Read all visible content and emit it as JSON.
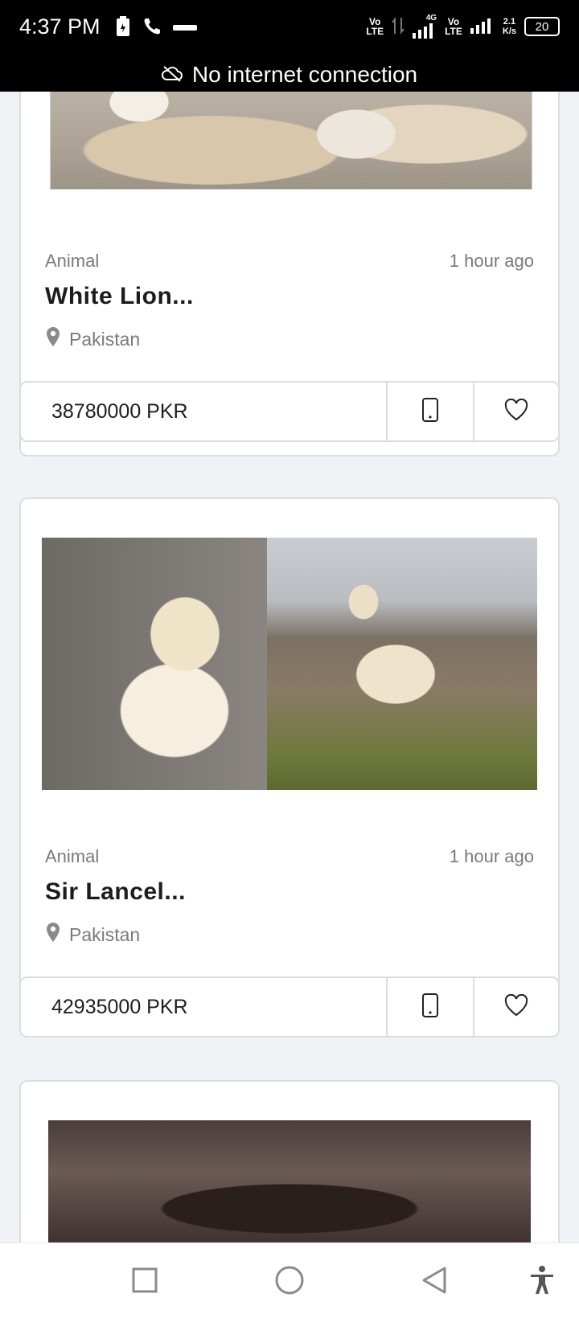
{
  "status_bar": {
    "time": "4:37 PM",
    "network_1": [
      "Vo",
      "LTE"
    ],
    "network_2": [
      "Vo",
      "LTE"
    ],
    "network_4g": "4G",
    "speed": [
      "2.1",
      "K/s"
    ],
    "battery": "20",
    "icons": [
      "battery-saver-icon",
      "phone-call-icon",
      "minus-icon",
      "signal-icon"
    ]
  },
  "banner": {
    "text": "No internet connection",
    "icon": "cloud-off-icon"
  },
  "listings": [
    {
      "category": "Animal",
      "time": "1 hour ago",
      "title": "White Lion...",
      "location": "Pakistan",
      "price": "38780000 PKR"
    },
    {
      "category": "Animal",
      "time": "1 hour ago",
      "title": "Sir Lancel...",
      "location": "Pakistan",
      "price": "42935000 PKR"
    }
  ],
  "navigation": {
    "icons": [
      "recent-apps-icon",
      "home-icon",
      "back-icon",
      "accessibility-icon"
    ]
  },
  "colors": {
    "background": "#f1f2f6",
    "card": "#ffffff",
    "border": "#dcdde3",
    "muted_text": "#7a7a7a"
  }
}
